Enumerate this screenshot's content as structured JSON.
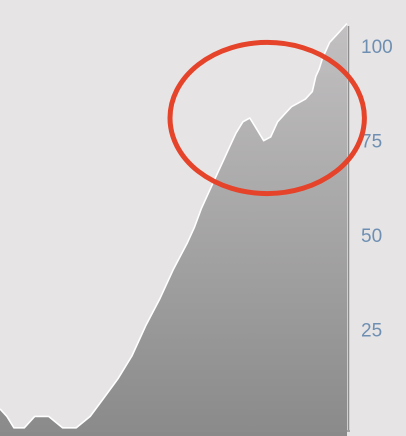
{
  "chart_data": {
    "type": "area",
    "title": "",
    "xlabel": "",
    "ylabel": "",
    "ylim": [
      0,
      108
    ],
    "yticks": [
      25,
      50,
      75,
      100
    ],
    "ytick_labels": [
      "25",
      "50",
      "75",
      "100"
    ],
    "y_axis_position": "right",
    "grid": false,
    "legend": "none",
    "series": [
      {
        "x": [
          0,
          2,
          4,
          7,
          10,
          14,
          18,
          22,
          26,
          30,
          34,
          38,
          42,
          46,
          50,
          54,
          56,
          58,
          60,
          62,
          64,
          66,
          68,
          70,
          72,
          74,
          76,
          78,
          80,
          82,
          84,
          86,
          88,
          90,
          91,
          92,
          93,
          94,
          95,
          96,
          97,
          98,
          99,
          100
        ],
        "values": [
          4,
          2,
          -1,
          -1,
          2,
          2,
          -1,
          -1,
          2,
          7,
          12,
          18,
          26,
          33,
          41,
          48,
          52,
          57,
          61,
          65,
          69,
          73,
          77,
          80,
          81,
          78,
          75,
          76,
          80,
          82,
          84,
          85,
          86,
          88,
          92,
          94,
          97,
          99,
          101,
          102,
          103,
          104,
          105,
          106
        ],
        "fill_top": "#c2c0c1",
        "fill_bottom": "#8a8a8a",
        "line_color": "#ffffff"
      }
    ],
    "annotations": [
      {
        "type": "ellipse",
        "color": "#e5432a",
        "cx": 77,
        "cy": 81,
        "rx": 28,
        "ry": 20
      }
    ],
    "axis_color": "#8d8d8d"
  }
}
